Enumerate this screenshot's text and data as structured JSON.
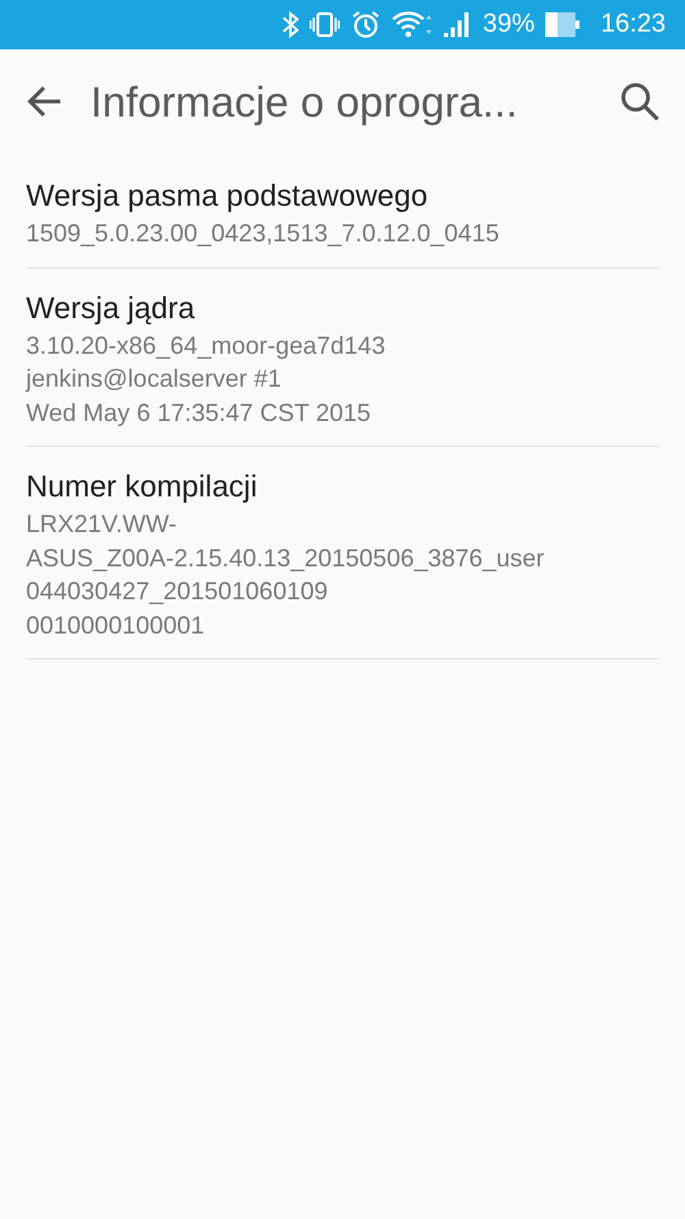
{
  "status_bar": {
    "battery": "39%",
    "time": "16:23"
  },
  "app_bar": {
    "title": "Informacje o oprogra..."
  },
  "items": [
    {
      "title": "Wersja pasma podstawowego",
      "lines": [
        "1509_5.0.23.00_0423,1513_7.0.12.0_0415"
      ]
    },
    {
      "title": "Wersja jądra",
      "lines": [
        "3.10.20-x86_64_moor-gea7d143",
        "jenkins@localserver #1",
        "Wed May 6 17:35:47 CST 2015"
      ]
    },
    {
      "title": "Numer kompilacji",
      "lines": [
        "LRX21V.WW-",
        "ASUS_Z00A-2.15.40.13_20150506_3876_user",
        "044030427_201501060109",
        "0010000100001"
      ]
    }
  ]
}
